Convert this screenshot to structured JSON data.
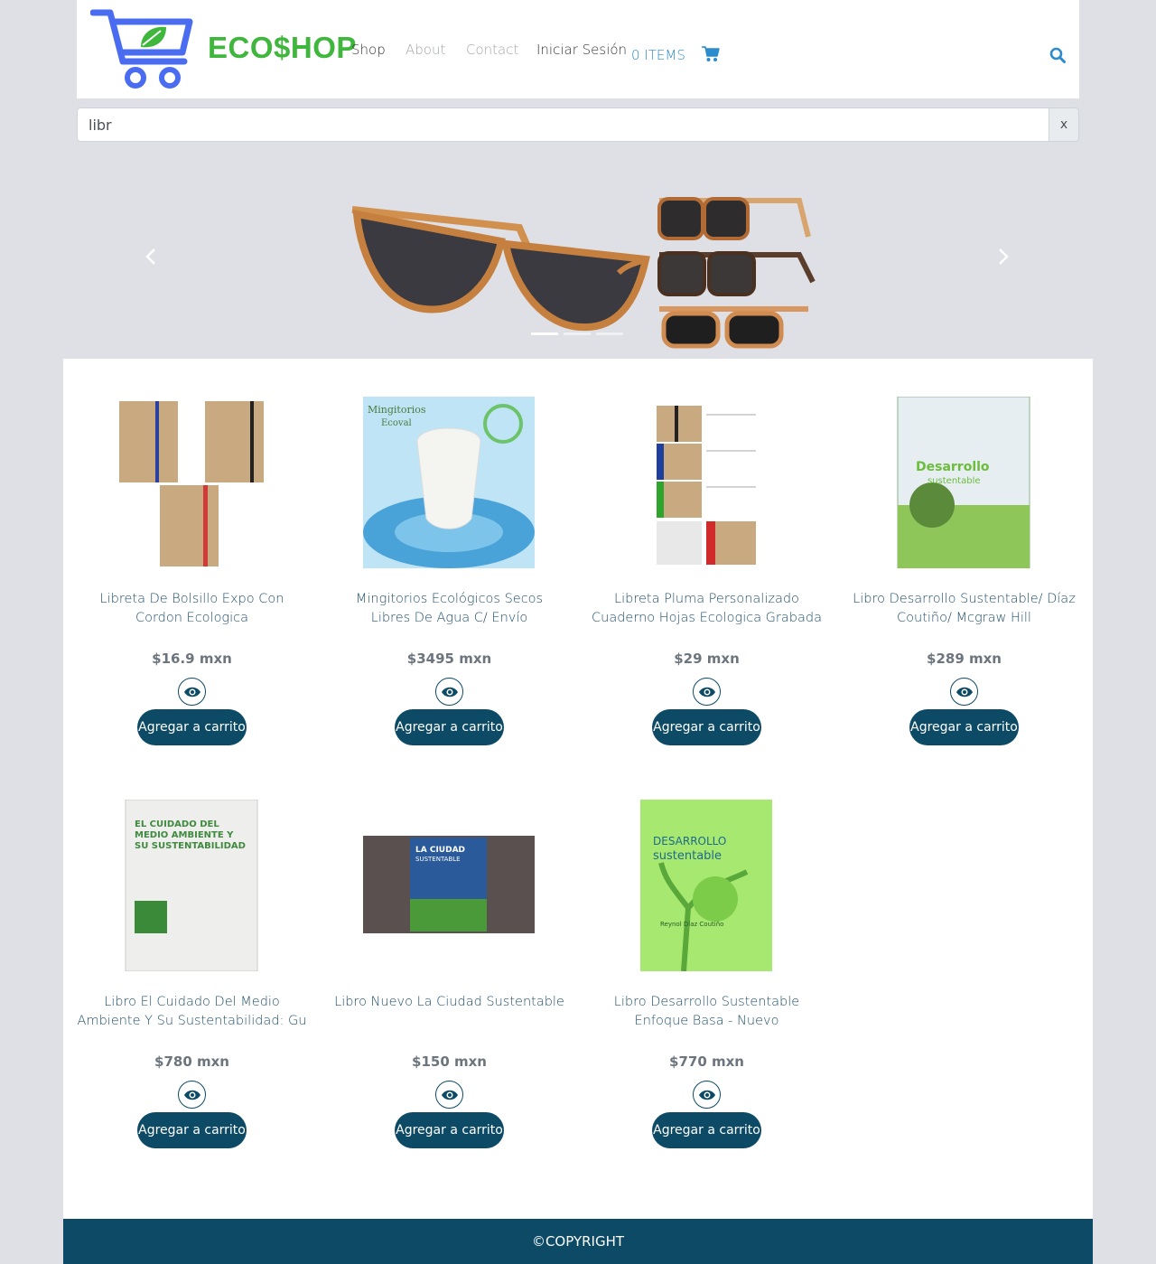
{
  "header": {
    "logo_text": "ECO$HOP",
    "nav": [
      "Shop",
      "About",
      "Contact",
      "Iniciar Sesión"
    ],
    "cart_label": "0 ITEMS",
    "colors": {
      "logo_green": "#3fb63c",
      "logo_blue": "#4a6cf0",
      "accent": "#2b8bcc"
    }
  },
  "search": {
    "value": "libr",
    "clear_label": "x"
  },
  "products": [
    {
      "name": "Libreta De Bolsillo Expo Con Cordon Ecologica",
      "price": "$16.9 mxn",
      "button": "Agregar a carrito"
    },
    {
      "name": "Mingitorios Ecológicos Secos Libres De Agua C/ Envío",
      "price": "$3495 mxn",
      "button": "Agregar a carrito"
    },
    {
      "name": "Libreta Pluma Personalizado Cuaderno Hojas Ecologica Grabada",
      "price": "$29 mxn",
      "button": "Agregar a carrito"
    },
    {
      "name": "Libro Desarrollo Sustentable/ Díaz Coutiño/ Mcgraw Hill",
      "price": "$289 mxn",
      "button": "Agregar a carrito"
    },
    {
      "name": "Libro El Cuidado Del Medio Ambiente Y Su Sustentabilidad: Gu",
      "price": "$780 mxn",
      "button": "Agregar a carrito"
    },
    {
      "name": "Libro Nuevo La Ciudad Sustentable",
      "price": "$150 mxn",
      "button": "Agregar a carrito"
    },
    {
      "name": "Libro Desarrollo Sustentable Enfoque Basa - Nuevo",
      "price": "$770 mxn",
      "button": "Agregar a carrito"
    }
  ],
  "product_images": {
    "p1_labels": [],
    "p2_labels": [
      "Mingitorios",
      "Ecoval"
    ],
    "p3_labels": [],
    "p4_labels": [
      "Desarrollo",
      "sustentable"
    ],
    "p5_labels": [
      "EL CUIDADO DEL",
      "MEDIO AMBIENTE Y",
      "SU SUSTENTABILIDAD"
    ],
    "p6_labels": [
      "LA CIUDAD",
      "SUSTENTABLE"
    ],
    "p7_labels": [
      "DESARROLLO",
      "sustentable",
      "Reynol Díaz Coutiño"
    ]
  },
  "footer": {
    "text": "©COPYRIGHT"
  }
}
